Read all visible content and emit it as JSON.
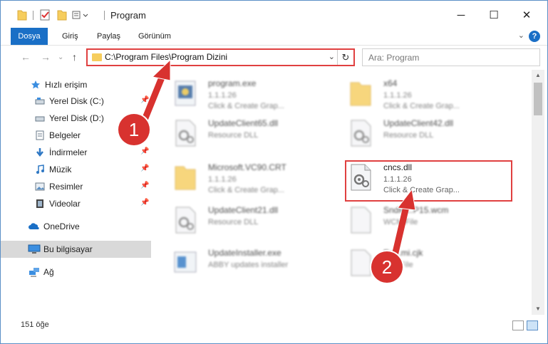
{
  "window": {
    "title": "Program",
    "minimize": "─",
    "maximize": "☐",
    "close": "✕"
  },
  "ribbon": {
    "tabs": [
      "Dosya",
      "Giriş",
      "Paylaş",
      "Görünüm"
    ],
    "help": "?"
  },
  "nav": {
    "address": "C:\\Program Files\\Program Dizini",
    "search_placeholder": "Ara: Program"
  },
  "sidebar": {
    "items": [
      {
        "label": "Hızlı erişim",
        "icon": "star-icon"
      },
      {
        "label": "Yerel Disk (C:)",
        "icon": "drive-icon"
      },
      {
        "label": "Yerel Disk (D:)",
        "icon": "drive-icon"
      },
      {
        "label": "Belgeler",
        "icon": "documents-icon"
      },
      {
        "label": "İndirmeler",
        "icon": "download-icon"
      },
      {
        "label": "Müzik",
        "icon": "music-icon"
      },
      {
        "label": "Resimler",
        "icon": "pictures-icon"
      },
      {
        "label": "Videolar",
        "icon": "videos-icon"
      },
      {
        "label": "OneDrive",
        "icon": "cloud-icon"
      },
      {
        "label": "Bu bilgisayar",
        "icon": "computer-icon"
      },
      {
        "label": "Ağ",
        "icon": "network-icon"
      }
    ]
  },
  "files": [
    {
      "name": "program.exe",
      "sub1": "1.1.1.26",
      "sub2": "Click & Create Grap...",
      "icon": "exe-icon"
    },
    {
      "name": "x64",
      "sub1": "1.1.1.26",
      "sub2": "Click & Create Grap...",
      "icon": "folder-icon"
    },
    {
      "name": "UpdateClient65.dll",
      "sub1": "Resource DLL",
      "sub2": "",
      "icon": "dll-icon"
    },
    {
      "name": "UpdateClient42.dll",
      "sub1": "Resource DLL",
      "sub2": "",
      "icon": "dll-icon"
    },
    {
      "name": "Microsoft.VC90.CRT",
      "sub1": "1.1.1.26",
      "sub2": "Click & Create Grap...",
      "icon": "folder-icon"
    },
    {
      "name": "cncs.dll",
      "sub1": "1.1.1.26",
      "sub2": "Click & Create Grap...",
      "icon": "dll-icon"
    },
    {
      "name": "UpdateClient21.dll",
      "sub1": "Resource DLL",
      "sub2": "",
      "icon": "dll-icon"
    },
    {
      "name": "SndPl...P15.wcm",
      "sub1": "WCM File",
      "sub2": "",
      "icon": "file-icon"
    },
    {
      "name": "UpdateInstaller.exe",
      "sub1": "ABBY updates installer",
      "sub2": "",
      "icon": "exe-icon"
    },
    {
      "name": "En...mi.cjk",
      "sub1": "CJK File",
      "sub2": "",
      "icon": "file-icon"
    }
  ],
  "status": {
    "count": "151 öğe"
  },
  "callouts": [
    "1",
    "2"
  ],
  "colors": {
    "accent": "#1a6fc6",
    "highlight": "#e04040",
    "badge": "#d8322f"
  }
}
